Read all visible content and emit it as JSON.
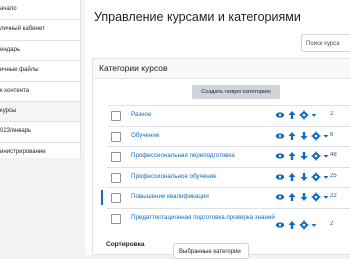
{
  "sidebar": {
    "items": [
      {
        "label": "ачало"
      },
      {
        "label": "личный кабинет"
      },
      {
        "label": "ендарь"
      },
      {
        "label": "ичные файлы"
      },
      {
        "label": "к контента"
      },
      {
        "label": "курсы"
      },
      {
        "label": "023/январь"
      },
      {
        "label": "инистрирование"
      }
    ]
  },
  "page": {
    "title": "Управление курсами и категориями",
    "search_placeholder": "Поиск курса"
  },
  "categories_panel": {
    "header": "Категории курсов",
    "create_button": "Создать новую категорию",
    "rows": [
      {
        "name": "Разное",
        "count": "2"
      },
      {
        "name": "Обучение",
        "count": "6"
      },
      {
        "name": "Профессиональная переподготовка",
        "count": "48"
      },
      {
        "name": "Профессиональное обучение",
        "count": "25"
      },
      {
        "name": "Повышение квалификации",
        "count": "22"
      },
      {
        "name": "Предаттестационная подготовка.проверка знаний",
        "count": "2"
      }
    ],
    "sort_label": "Сортировка",
    "sort_value": "Выбранные категории"
  },
  "colors": {
    "accent": "#0f6cbf",
    "text": "#1d2125"
  },
  "icons": [
    "eye-icon",
    "arrow-up-icon",
    "arrow-down-icon",
    "gear-icon",
    "chevron-down-icon"
  ]
}
